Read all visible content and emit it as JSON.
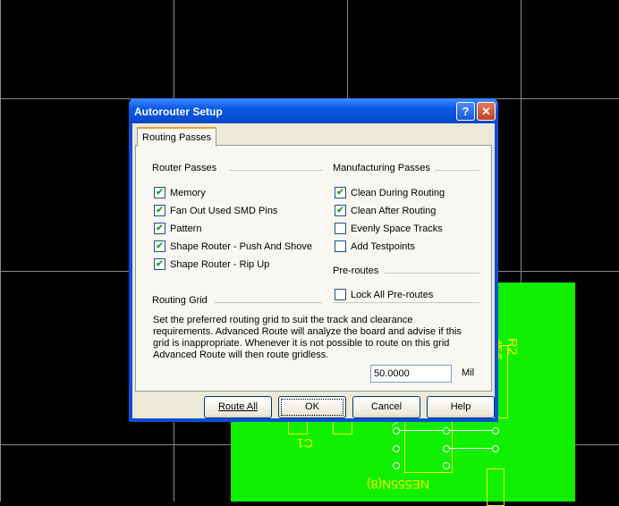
{
  "dialog": {
    "title": "Autorouter Setup",
    "help_glyph": "?",
    "close_glyph": "✕",
    "tab": "Routing Passes",
    "router_passes": {
      "heading": "Router Passes",
      "items": [
        {
          "label": "Memory",
          "checked": true
        },
        {
          "label": "Fan Out Used SMD Pins",
          "checked": true
        },
        {
          "label": "Pattern",
          "checked": true
        },
        {
          "label": "Shape Router - Push And Shove",
          "checked": true
        },
        {
          "label": "Shape Router - Rip Up",
          "checked": true
        }
      ]
    },
    "manufacturing_passes": {
      "heading": "Manufacturing Passes",
      "items": [
        {
          "label": "Clean During Routing",
          "checked": true
        },
        {
          "label": "Clean After Routing",
          "checked": true
        },
        {
          "label": "Evenly Space Tracks",
          "checked": false
        },
        {
          "label": "Add Testpoints",
          "checked": false
        }
      ]
    },
    "preroutes": {
      "heading": "Pre-routes",
      "items": [
        {
          "label": "Lock All Pre-routes",
          "checked": false
        }
      ]
    },
    "routing_grid": {
      "heading": "Routing Grid",
      "description": "Set the preferred routing grid to suit the track and clearance requirements. Advanced Route will analyze the board and advise if this grid is inappropriate. Whenever it is not possible to route on this grid Advanced Route will then route gridless.",
      "value": "50.0000",
      "unit": "Mil"
    },
    "buttons": {
      "route_all": "Route All",
      "ok": "OK",
      "cancel": "Cancel",
      "help": "Help"
    }
  },
  "pcb": {
    "labels": {
      "r2": "R2",
      "r2_value": "456",
      "c1": "C1",
      "ic": "NE555N(8)"
    }
  },
  "colors": {
    "board": "#10f000",
    "silkscreen": "#f4f400",
    "titlebar": "#0a5ae8"
  }
}
